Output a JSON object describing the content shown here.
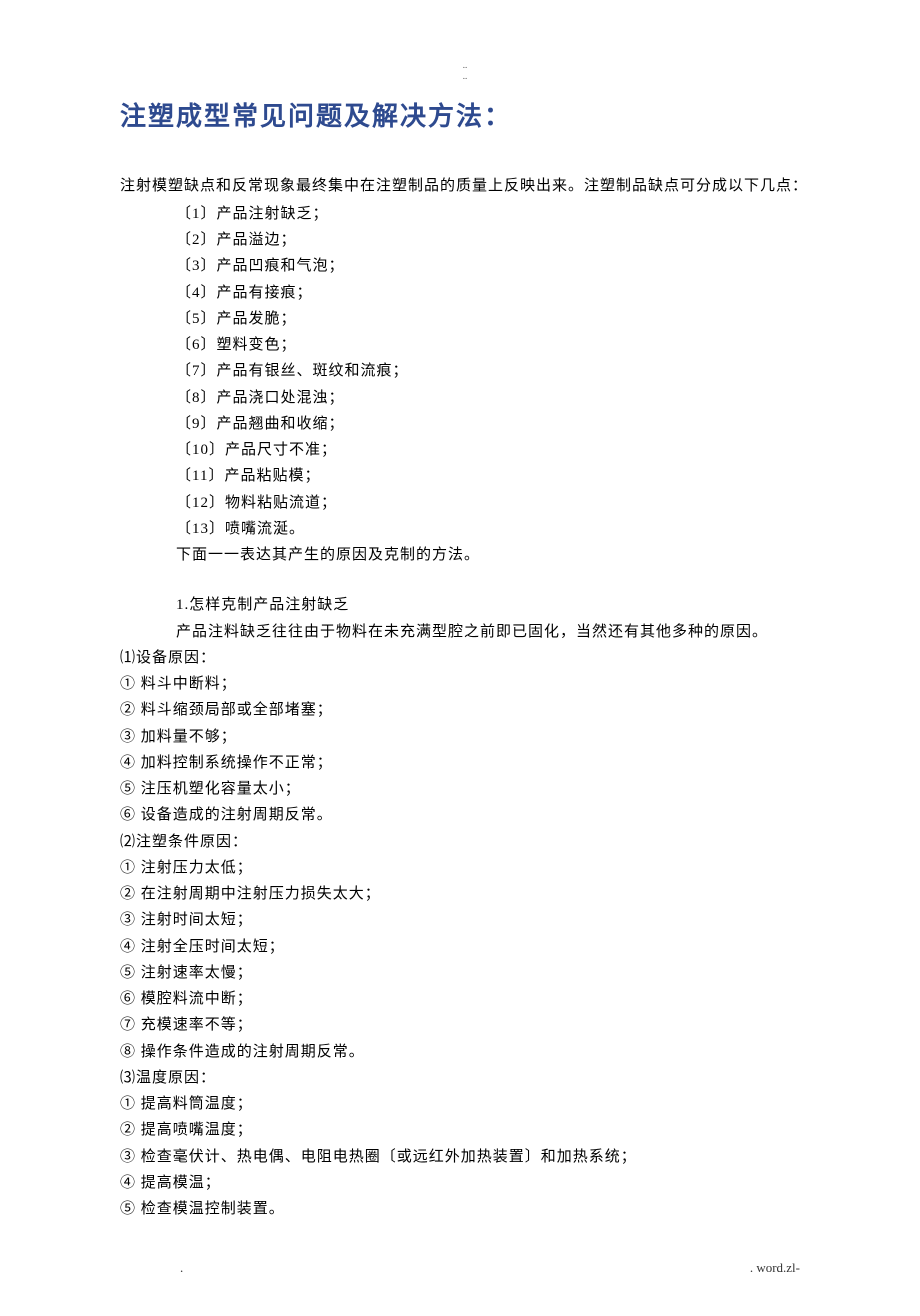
{
  "header_dots_1": "..",
  "header_dots_2": "..",
  "title": "注塑成型常见问题及解决方法：",
  "intro": "注射模塑缺点和反常现象最终集中在注塑制品的质量上反映出来。注塑制品缺点可分成以下几点：",
  "defects": [
    "〔1〕产品注射缺乏；",
    "〔2〕产品溢边；",
    "〔3〕产品凹痕和气泡；",
    "〔4〕产品有接痕；",
    "〔5〕产品发脆；",
    "〔6〕塑料变色；",
    "〔7〕产品有银丝、斑纹和流痕；",
    "〔8〕产品浇口处混浊；",
    "〔9〕产品翘曲和收缩；",
    "〔10〕产品尺寸不准；",
    "〔11〕产品粘贴模；",
    "〔12〕物料粘贴流道；",
    "〔13〕喷嘴流涎。"
  ],
  "transition": "下面一一表达其产生的原因及克制的方法。",
  "section1": {
    "q": "1.怎样克制产品注射缺乏",
    "desc": "产品注料缺乏往往由于物料在未充满型腔之前即已固化，当然还有其他多种的原因。",
    "groups": [
      {
        "label": "⑴设备原因：",
        "items": [
          "① 料斗中断料；",
          "② 料斗缩颈局部或全部堵塞；",
          "③ 加料量不够；",
          "④ 加料控制系统操作不正常；",
          "⑤ 注压机塑化容量太小；",
          "⑥ 设备造成的注射周期反常。"
        ]
      },
      {
        "label": "⑵注塑条件原因：",
        "items": [
          "① 注射压力太低；",
          "② 在注射周期中注射压力损失太大；",
          "③ 注射时间太短；",
          "④ 注射全压时间太短；",
          "⑤ 注射速率太慢；",
          "⑥ 模腔料流中断；",
          "⑦ 充模速率不等；",
          "⑧ 操作条件造成的注射周期反常。"
        ]
      },
      {
        "label": "⑶温度原因：",
        "items": [
          "① 提高料筒温度；",
          "② 提高喷嘴温度；",
          "③ 检查毫伏计、热电偶、电阻电热圈〔或远红外加热装置〕和加热系统；",
          "④ 提高模温；",
          "⑤ 检查模温控制装置。"
        ]
      }
    ]
  },
  "footer_left": ".",
  "footer_right": ". word.zl-"
}
